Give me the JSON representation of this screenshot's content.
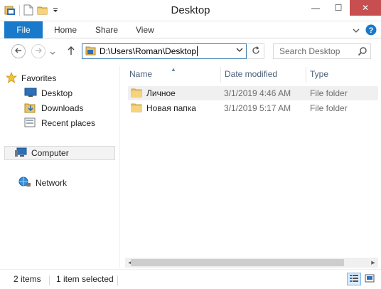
{
  "window": {
    "title": "Desktop",
    "controls": {
      "minimize": "—",
      "maximize": "☐",
      "close": "✕"
    }
  },
  "ribbon": {
    "tabs": [
      {
        "label": "File",
        "active": true
      },
      {
        "label": "Home"
      },
      {
        "label": "Share"
      },
      {
        "label": "View"
      }
    ]
  },
  "address": {
    "path": "D:\\Users\\Roman\\Desktop",
    "search_placeholder": "Search Desktop"
  },
  "navigation": {
    "favorites_label": "Favorites",
    "favorites": [
      {
        "label": "Desktop",
        "icon": "desktop-icon"
      },
      {
        "label": "Downloads",
        "icon": "downloads-icon"
      },
      {
        "label": "Recent places",
        "icon": "recent-places-icon"
      }
    ],
    "computer_label": "Computer",
    "network_label": "Network"
  },
  "file_list": {
    "columns": [
      "Name",
      "Date modified",
      "Type"
    ],
    "sort_column": "Name",
    "rows": [
      {
        "name": "Личное",
        "date": "3/1/2019 4:46 AM",
        "type": "File folder",
        "icon": "folder-icon"
      },
      {
        "name": "Новая папка",
        "date": "3/1/2019 5:17 AM",
        "type": "File folder",
        "icon": "folder-icon"
      }
    ]
  },
  "status": {
    "item_count": "2 items",
    "selection": "1 item selected"
  },
  "colors": {
    "file_tab": "#1979ca",
    "close_button": "#c74f50",
    "address_border": "#3c7fb1",
    "folder": "#e8c36b",
    "header_text": "#4c607a"
  }
}
